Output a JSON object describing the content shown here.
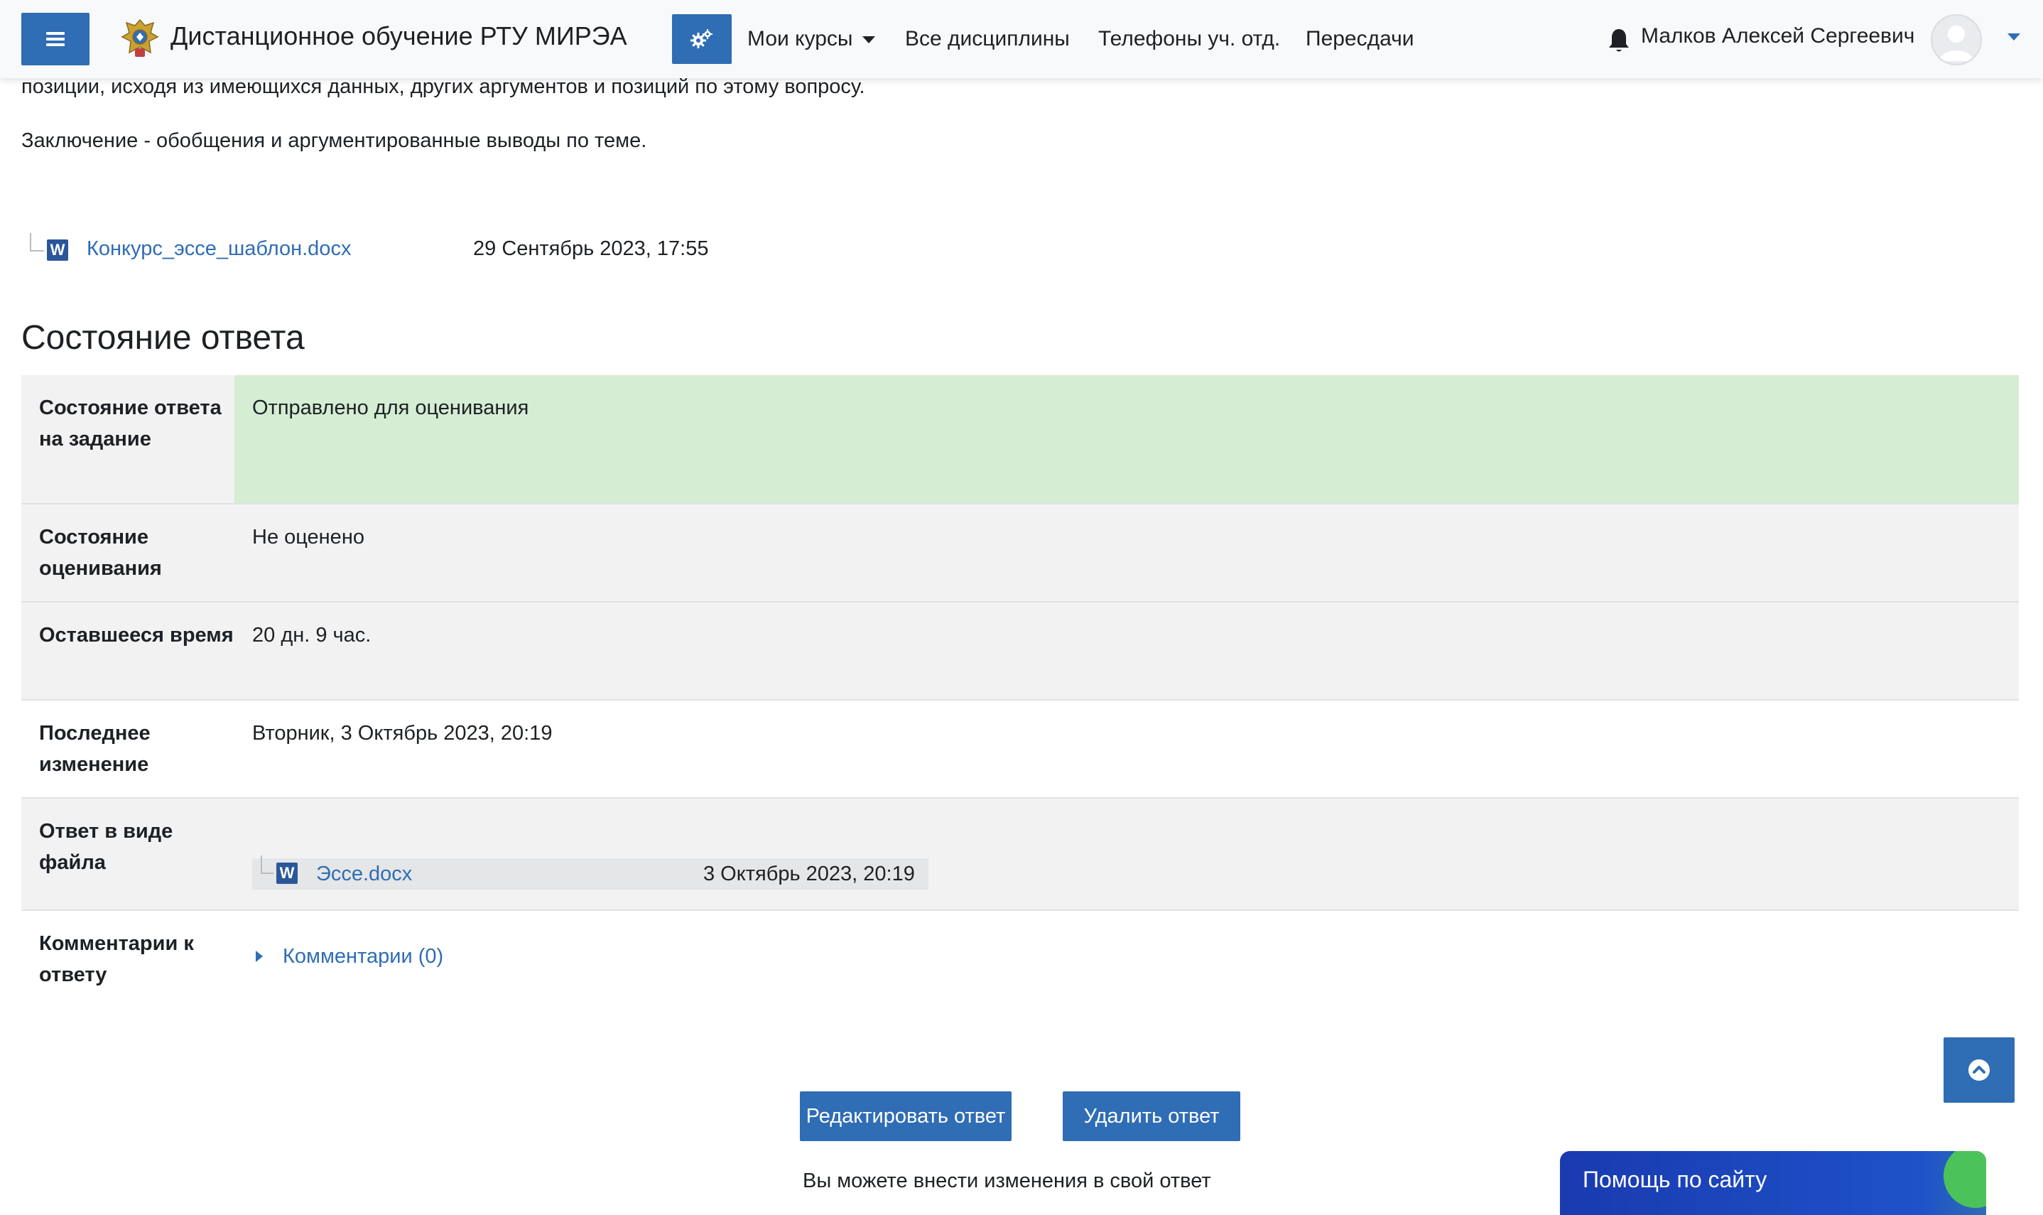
{
  "navbar": {
    "site_name": "Дистанционное обучение РТУ МИРЭА",
    "links": [
      "Мои курсы",
      "Все дисциплины",
      "Телефоны уч. отд.",
      "Пересдачи"
    ],
    "user_name": "Малков Алексей Сергеевич",
    "accent_color": "#2f6db4"
  },
  "intro": {
    "line1": "позиции, исходя из имеющихся данных, других аргументов и позиций по этому вопросу.",
    "line2": "Заключение - обобщения и аргументированные выводы по теме."
  },
  "template_file": {
    "name": "Конкурс_эссе_шаблон.docx",
    "date": "29 Сентябрь 2023, 17:55",
    "icon": "word-doc-icon"
  },
  "section_title": "Состояние ответа",
  "status": {
    "rows": [
      {
        "label": "Состояние ответа на задание",
        "value": "Отправлено для оценивания"
      },
      {
        "label": "Состояние оценивания",
        "value": "Не оценено"
      },
      {
        "label": "Оставшееся время",
        "value": "20 дн. 9 час."
      },
      {
        "label": "Последнее изменение",
        "value": "Вторник, 3 Октябрь 2023, 20:19"
      },
      {
        "label": "Ответ в виде файла",
        "file_name": "Эссе.docx",
        "file_date": "3 Октябрь 2023, 20:19"
      },
      {
        "label": "Комментарии к ответу",
        "comments_link": "Комментарии (0)"
      }
    ],
    "submitted_color": "#d4edd3"
  },
  "actions": {
    "edit_label": "Редактировать ответ",
    "delete_label": "Удалить ответ",
    "hint": "Вы можете внести изменения в свой ответ"
  },
  "help": {
    "label": "Помощь по сайту"
  }
}
